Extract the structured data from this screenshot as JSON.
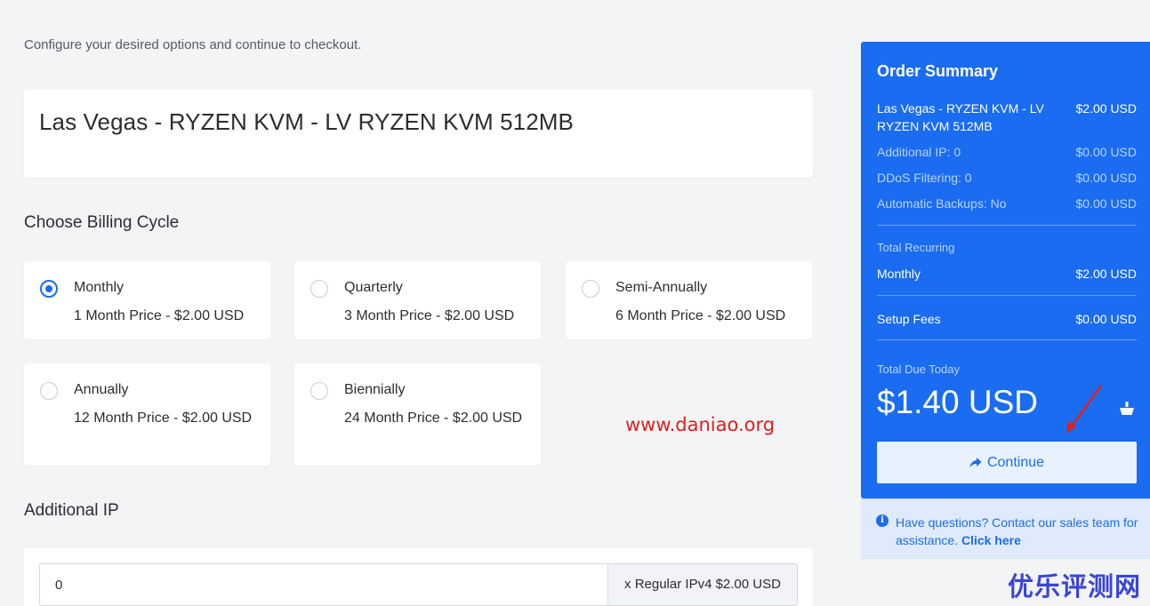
{
  "intro_text": "Configure your desired options and continue to checkout.",
  "product_title": "Las Vegas - RYZEN KVM - LV RYZEN KVM 512MB",
  "billing": {
    "title": "Choose Billing Cycle",
    "options": [
      {
        "name": "Monthly",
        "price": "1 Month Price - $2.00 USD",
        "selected": true
      },
      {
        "name": "Quarterly",
        "price": "3 Month Price - $2.00 USD",
        "selected": false
      },
      {
        "name": "Semi-Annually",
        "price": "6 Month Price - $2.00 USD",
        "selected": false
      },
      {
        "name": "Annually",
        "price": "12 Month Price - $2.00 USD",
        "selected": false
      },
      {
        "name": "Biennially",
        "price": "24 Month Price - $2.00 USD",
        "selected": false
      }
    ]
  },
  "watermark_url": "www.daniao.org",
  "additional_ip": {
    "title": "Additional IP",
    "value": "0",
    "addon": "x Regular IPv4 $2.00 USD"
  },
  "summary": {
    "title": "Order Summary",
    "items": [
      {
        "label": "Las Vegas - RYZEN KVM - LV RYZEN KVM 512MB",
        "price": "$2.00 USD"
      },
      {
        "label": "Additional IP: 0",
        "price": "$0.00 USD"
      },
      {
        "label": "DDoS Filtering: 0",
        "price": "$0.00 USD"
      },
      {
        "label": "Automatic Backups: No",
        "price": "$0.00 USD"
      }
    ],
    "recurring_label": "Total Recurring",
    "recurring": {
      "label": "Monthly",
      "price": "$2.00 USD"
    },
    "setup": {
      "label": "Setup Fees",
      "price": "$0.00 USD"
    },
    "due_label": "Total Due Today",
    "due_amount": "$1.40 USD",
    "continue_label": "Continue"
  },
  "help": {
    "text": "Have questions? Contact our sales team for assistance.",
    "link": "Click here"
  },
  "brand_watermark": "优乐评测网",
  "colors": {
    "accent": "#1a6cf0",
    "watermark_red": "#e0201b"
  },
  "icons": {
    "continue": "share-arrow-icon",
    "cart": "shopping-basket-icon",
    "help": "info-circle-icon"
  }
}
